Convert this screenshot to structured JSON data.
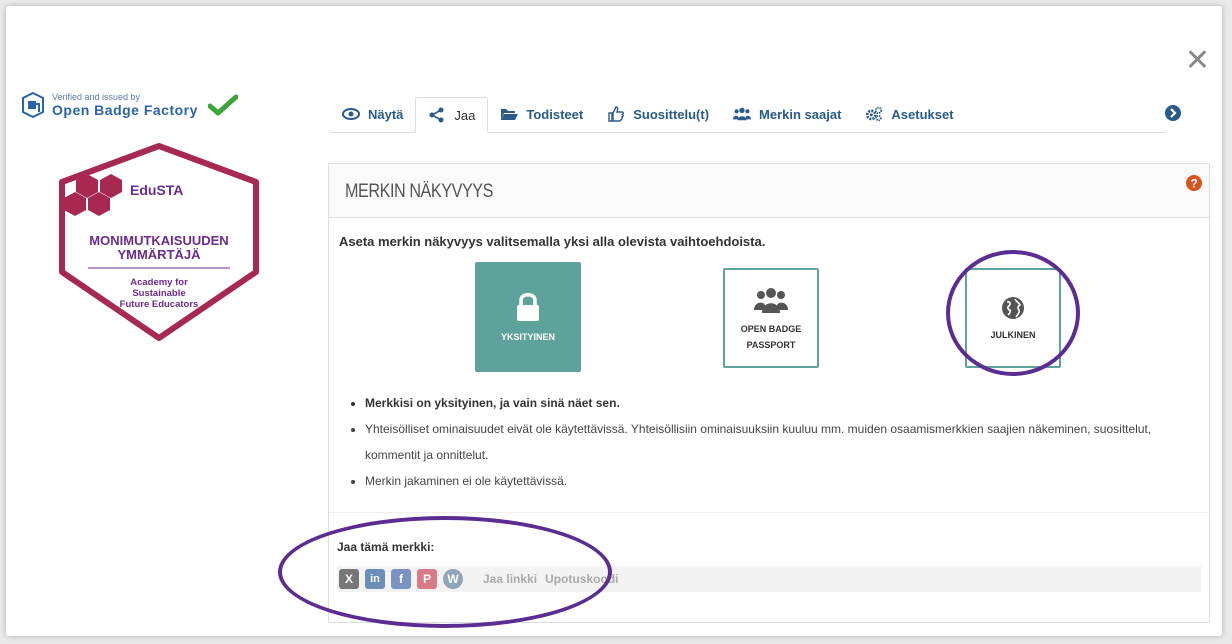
{
  "window": {
    "close_glyph": "✕"
  },
  "issuer": {
    "verified_text": "Verified and issued by",
    "name": "Open Badge Factory",
    "logo_icon": "obf-cube-icon",
    "check_icon": "check-icon",
    "check_color": "#3aa63a"
  },
  "badge": {
    "org": "EduSTA",
    "title_line1": "MONIMUTKAISUUDEN",
    "title_line2": "YMMÄRTÄJÄ",
    "sub_line1": "Academy for",
    "sub_line2": "Sustainable",
    "sub_line3": "Future Educators",
    "frame_color": "#a8294f",
    "text_color": "#6a2c8f"
  },
  "tabs": [
    {
      "label": "Näytä",
      "icon": "eye-icon"
    },
    {
      "label": "Jaa",
      "icon": "share-icon",
      "active": true
    },
    {
      "label": "Todisteet",
      "icon": "folder-open-icon"
    },
    {
      "label": "Suosittelu(t)",
      "icon": "thumbs-up-icon"
    },
    {
      "label": "Merkin saajat",
      "icon": "users-icon"
    },
    {
      "label": "Asetukset",
      "icon": "gears-icon"
    }
  ],
  "panel": {
    "title": "MERKIN NÄKYVYYS",
    "instruction": "Aseta merkin näkyvyys valitsemalla yksi alla olevista vaihtoehdoista.",
    "options": {
      "private": "YKSITYINEN",
      "obp_line1": "OPEN BADGE",
      "obp_line2": "PASSPORT",
      "public": "JULKINEN"
    },
    "bullets": [
      "Merkkisi on yksityinen, ja vain sinä näet sen.",
      "Yhteisölliset ominaisuudet eivät ole käytettävissä. Yhteisöllisiin ominaisuuksiin kuuluu mm. muiden osaamismerkkien saajien näkeminen, suosittelut, kommentit ja onnittelut.",
      "Merkin jakaminen ei ole käytettävissä."
    ],
    "share_label": "Jaa tämä merkki:",
    "share_link": "Jaa linkki",
    "share_embed": "Upotuskoodi",
    "social": {
      "x": "X",
      "linkedin": "in",
      "facebook": "f",
      "pinterest": "P",
      "wordpress": "W"
    }
  },
  "colors": {
    "accent_teal": "#5ea39b",
    "highlight_purple": "#5b2d92",
    "link_blue": "#2a5a8a"
  }
}
